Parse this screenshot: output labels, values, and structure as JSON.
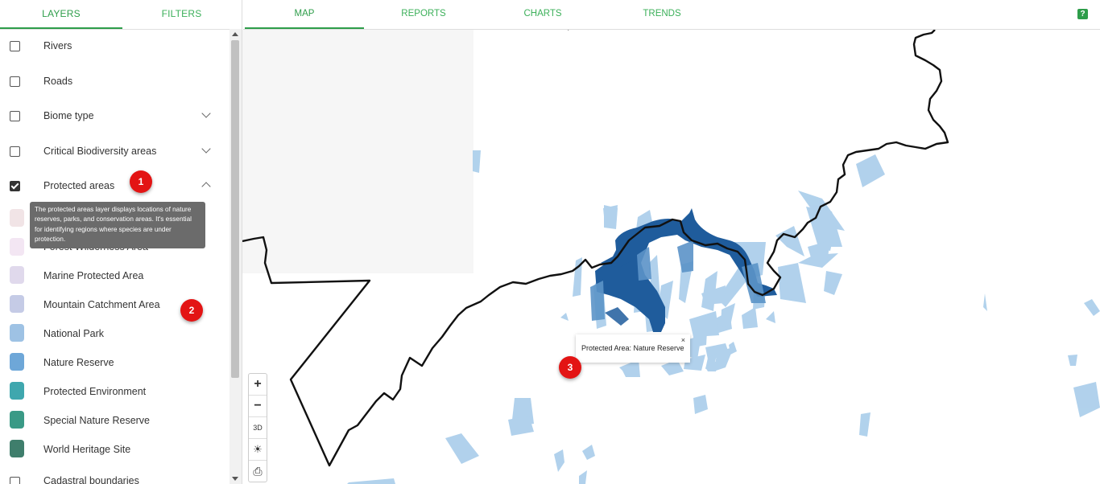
{
  "left_panel": {
    "tabs": [
      "LAYERS",
      "FILTERS"
    ]
  },
  "layers": [
    {
      "label": "Rivers",
      "checked": false,
      "expand": "none"
    },
    {
      "label": "Roads",
      "checked": false,
      "expand": "none"
    },
    {
      "label": "Biome type",
      "checked": false,
      "expand": "down"
    },
    {
      "label": "Critical Biodiversity areas",
      "checked": false,
      "expand": "down"
    },
    {
      "label": "Protected areas",
      "checked": true,
      "expand": "up"
    }
  ],
  "legend": [
    {
      "label": "Forest Wilderness Area",
      "color": "#f3e6f3"
    },
    {
      "label": "Marine Protected Area",
      "color": "#e0d9ec"
    },
    {
      "label": "Mountain Catchment Area",
      "color": "#c5cbe6"
    },
    {
      "label": "National Park",
      "color": "#9ec2e4"
    },
    {
      "label": "Nature Reserve",
      "color": "#6ea7d8"
    },
    {
      "label": "Protected Environment",
      "color": "#3fa7ae"
    },
    {
      "label": "Special Nature Reserve",
      "color": "#3a9a86"
    },
    {
      "label": "World Heritage Site",
      "color": "#3f7e6c"
    }
  ],
  "legend_hidden_color": "#f1e4e6",
  "cadastral": {
    "label": "Cadastral boundaries",
    "checked": false
  },
  "tooltip": {
    "text": "The protected areas layer displays locations of nature reserves, parks, and conservation areas. It's essential for identifying regions where species are under protection."
  },
  "markers": [
    "1",
    "2",
    "3"
  ],
  "top_nav": {
    "tabs": [
      "MAP",
      "REPORTS",
      "CHARTS",
      "TRENDS"
    ],
    "help": "?"
  },
  "map": {
    "controls": {
      "zoom_in": "+",
      "zoom_out": "−",
      "three_d": "3D",
      "brightness": "☀",
      "print": "⎙"
    },
    "popup": {
      "text": "Protected Area: Nature Reserve",
      "close": "×"
    },
    "colors": {
      "light_area": "#a9cdea",
      "dark_area": "#1f5c9c",
      "boundary": "#111111"
    }
  }
}
